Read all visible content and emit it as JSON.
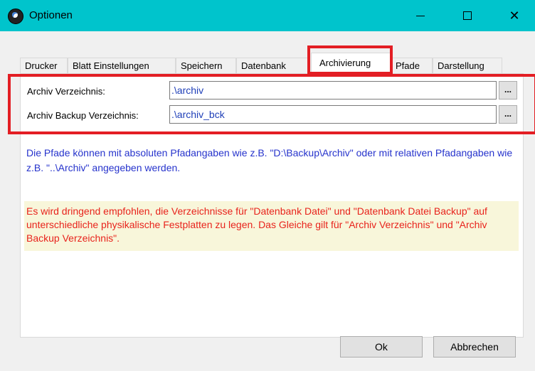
{
  "window": {
    "title": "Optionen",
    "title_bar_color": "#00C4CC",
    "controls": {
      "minimize": "minimize-icon",
      "maximize": "maximize-icon",
      "close": "✕"
    }
  },
  "tabs": [
    {
      "label": "Drucker",
      "active": false
    },
    {
      "label": "Blatt Einstellungen",
      "active": false
    },
    {
      "label": "Speichern",
      "active": false
    },
    {
      "label": "Datenbank",
      "active": false
    },
    {
      "label": "Archivierung",
      "active": true
    },
    {
      "label": "Pfade",
      "active": false
    },
    {
      "label": "Darstellung",
      "active": false
    }
  ],
  "form": {
    "archive_dir_label": "Archiv Verzeichnis:",
    "archive_dir_value": ".\\archiv",
    "backup_dir_label": "Archiv Backup Verzeichnis:",
    "backup_dir_value": ".\\archiv_bck",
    "browse_label": "..."
  },
  "info": {
    "paths_note": "Die Pfade können mit absoluten Pfadangaben wie z.B. \"D:\\Backup\\Archiv\" oder mit relativen Pfadangaben wie z.B. \"..\\Archiv\" angegeben werden.",
    "warning": "Es wird dringend empfohlen, die Verzeichnisse für \"Datenbank Datei\" und \"Datenbank Datei Backup\" auf unterschiedliche physikalische Festplatten zu legen. Das Gleiche gilt für \"Archiv Verzeichnis\" und \"Archiv Backup Verzeichnis\"."
  },
  "buttons": {
    "ok": "Ok",
    "cancel": "Abbrechen"
  },
  "colors": {
    "highlight": "#E31E24",
    "info_text": "#2633CC",
    "warning_text": "#E8231C",
    "warning_bg": "#F8F6DA"
  }
}
